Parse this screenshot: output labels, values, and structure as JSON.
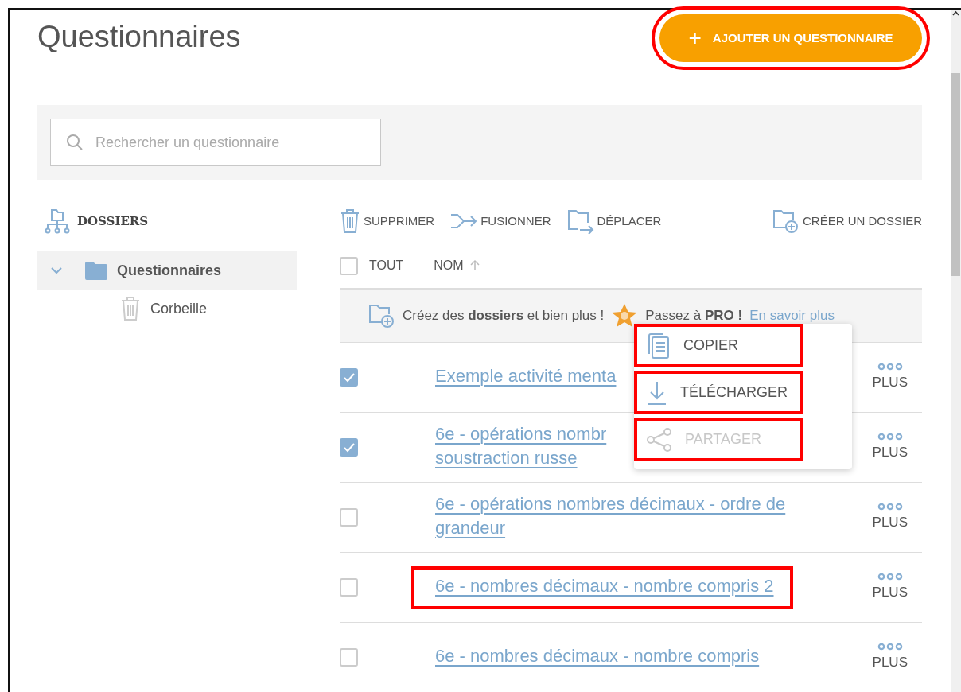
{
  "page": {
    "title": "Questionnaires"
  },
  "add_button": {
    "label": "AJOUTER UN QUESTIONNAIRE",
    "icon": "+",
    "highlighted": true
  },
  "search": {
    "placeholder": "Rechercher un questionnaire"
  },
  "sidebar": {
    "heading": "DOSSIERS",
    "items": [
      {
        "label": "Questionnaires",
        "kind": "folder",
        "selected": true,
        "expanded": true
      },
      {
        "label": "Corbeille",
        "kind": "trash",
        "selected": false
      }
    ]
  },
  "toolbar": [
    {
      "label": "SUPPRIMER",
      "kind": "trash"
    },
    {
      "label": "FUSIONNER",
      "kind": "merge"
    },
    {
      "label": "DÉPLACER",
      "kind": "move"
    },
    {
      "label": "CRÉER UN DOSSIER",
      "kind": "new-folder"
    }
  ],
  "table": {
    "select_all": {
      "label": "TOUT",
      "checked": false
    },
    "name_column": {
      "label": "NOM",
      "sort_ascending": true
    },
    "promo": {
      "text": "Créez des **dossiers** et bien plus !",
      "pro": "Passez à **PRO !**",
      "link": "En savoir plus"
    },
    "rows": [
      {
        "lines": [
          "Exemple activité menta"
        ],
        "checked": true,
        "highlighted": false,
        "more": "PLUS"
      },
      {
        "lines": [
          "6e - opérations nombr",
          "soustraction russe"
        ],
        "checked": true,
        "highlighted": false,
        "more": "PLUS"
      },
      {
        "lines": [
          "6e - opérations nombres décimaux - ordre de",
          "grandeur"
        ],
        "checked": false,
        "highlighted": false,
        "more": "PLUS"
      },
      {
        "lines": [
          "6e - nombres décimaux - nombre compris 2"
        ],
        "checked": false,
        "highlighted": true,
        "more": "PLUS"
      },
      {
        "lines": [
          "6e - nombres décimaux - nombre compris"
        ],
        "checked": false,
        "highlighted": false,
        "more": "PLUS"
      }
    ]
  },
  "context_menu": {
    "items": [
      {
        "label": "COPIER",
        "kind": "copy",
        "disabled": false,
        "highlighted": true
      },
      {
        "label": "TÉLÉCHARGER",
        "kind": "download",
        "disabled": false,
        "highlighted": true
      },
      {
        "label": "PARTAGER",
        "kind": "share",
        "disabled": true,
        "highlighted": true
      }
    ]
  }
}
